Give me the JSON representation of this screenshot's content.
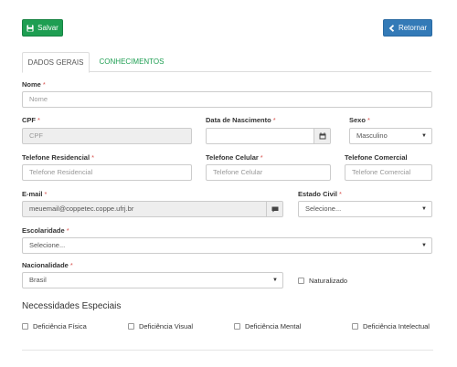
{
  "toolbar": {
    "save_label": "Salvar",
    "back_label": "Retornar",
    "save_icon": "floppy-disk-icon",
    "back_icon": "chevron-left-icon"
  },
  "tabs": [
    {
      "label": "DADOS GERAIS",
      "active": true
    },
    {
      "label": "CONHECIMENTOS",
      "active": false
    }
  ],
  "colors": {
    "success": "#1e9e52",
    "primary": "#337ab7",
    "required": "#d9534f"
  },
  "form": {
    "nome": {
      "label": "Nome",
      "required": "*",
      "value": "",
      "placeholder": "Nome"
    },
    "cpf": {
      "label": "CPF",
      "required": "*",
      "value": "",
      "placeholder": "CPF"
    },
    "nascimento": {
      "label": "Data de Nascimento",
      "required": "*",
      "value": "",
      "icon": "calendar-icon"
    },
    "sexo": {
      "label": "Sexo",
      "required": "*",
      "value": "Masculino"
    },
    "tel_residencial": {
      "label": "Telefone Residencial",
      "required": "*",
      "placeholder": "Telefone Residencial"
    },
    "tel_celular": {
      "label": "Telefone Celular",
      "required": "*",
      "placeholder": "Telefone Celular"
    },
    "tel_comercial": {
      "label": "Telefone Comercial",
      "placeholder": "Telefone Comercial"
    },
    "email": {
      "label": "E-mail",
      "required": "*",
      "value": "meuemail@coppetec.coppe.ufrj.br",
      "icon": "message-icon"
    },
    "estado_civil": {
      "label": "Estado Civil",
      "required": "*",
      "value": "Selecione..."
    },
    "escolaridade": {
      "label": "Escolaridade",
      "required": "*",
      "value": "Selecione..."
    },
    "nacionalidade": {
      "label": "Nacionalidade",
      "required": "*",
      "value": "Brasil"
    },
    "naturalizado": {
      "label": "Naturalizado"
    }
  },
  "necessidades": {
    "title": "Necessidades Especiais",
    "items": [
      "Deficiência Física",
      "Deficiência Visual",
      "Deficiência Mental",
      "Deficiência Intelectual"
    ]
  }
}
